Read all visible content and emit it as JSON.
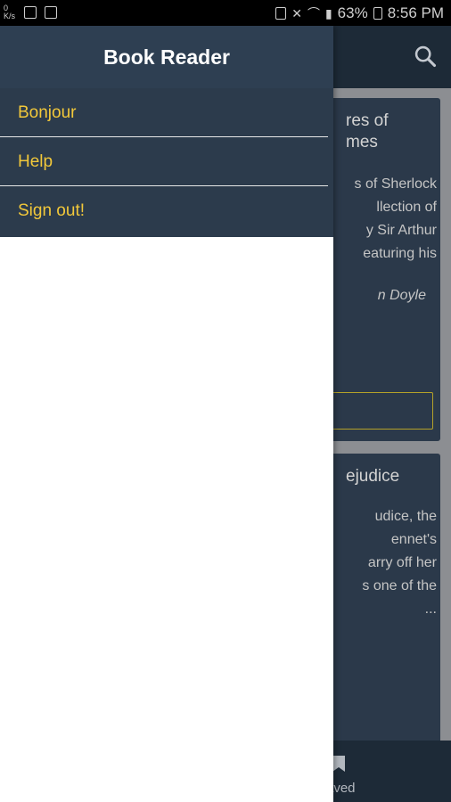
{
  "status_bar": {
    "battery_text": "63%",
    "time": "8:56 PM",
    "left_icons": [
      "network-speed-icon",
      "image-icon",
      "notes-icon"
    ],
    "right_icons": [
      "nfc-icon",
      "mute-icon",
      "wifi-icon",
      "signal-icon",
      "battery-icon"
    ]
  },
  "drawer": {
    "title": "Book Reader",
    "items": [
      {
        "label": "Bonjour"
      },
      {
        "label": "Help"
      },
      {
        "label": "Sign out!"
      }
    ]
  },
  "background": {
    "search_icon": "search-icon",
    "cards": [
      {
        "title": "res of\nmes",
        "desc": "s of Sherlock\nllection of\ny Sir Arthur\neaturing his",
        "author": "n Doyle"
      },
      {
        "title": "ejudice",
        "desc": "udice, the\nennet's\narry off her\ns one of the\n...",
        "author": ""
      }
    ],
    "bottom_nav": {
      "saved_label": "aved",
      "saved_icon": "bookmark-icon"
    }
  },
  "colors": {
    "accent": "#f2c83a",
    "drawer_header": "#2e3f52",
    "drawer_menu": "#2c3b4c",
    "app_dark": "#1e2b39"
  }
}
